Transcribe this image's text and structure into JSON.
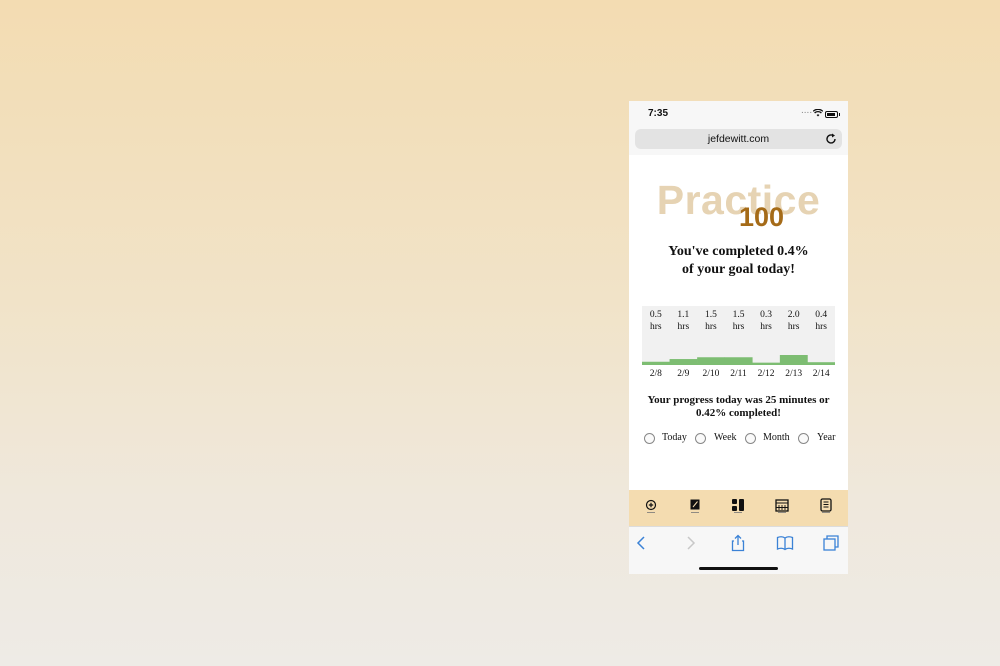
{
  "status": {
    "time": "7:35",
    "signal_dots": "....",
    "icons": [
      "wifi-icon",
      "battery-icon"
    ]
  },
  "browser": {
    "url": "jefdewitt.com",
    "reload_icon": "reload-icon"
  },
  "app": {
    "logo_word": "Practice",
    "logo_number": "100",
    "headline_line1": "You've completed 0.4%",
    "headline_line2": "of your goal today!",
    "progress_line1": "Your progress today was 25 minutes or",
    "progress_line2": "0.42% completed!",
    "range_options": [
      {
        "label": "Today",
        "selected": false
      },
      {
        "label": "Week",
        "selected": false
      },
      {
        "label": "Month",
        "selected": false
      },
      {
        "label": "Year",
        "selected": false
      }
    ],
    "bottom_nav_icons": [
      "add-entry-icon",
      "edit-log-icon",
      "stats-icon",
      "calendar-icon",
      "list-icon"
    ]
  },
  "chart_data": {
    "type": "bar",
    "categories": [
      "2/8",
      "2/9",
      "2/10",
      "2/11",
      "2/12",
      "2/13",
      "2/14"
    ],
    "values": [
      0.5,
      1.1,
      1.5,
      1.5,
      0.3,
      2.0,
      0.4
    ],
    "value_labels": [
      "0.5",
      "1.1",
      "1.5",
      "1.5",
      "0.3",
      "2.0",
      "0.4"
    ],
    "unit_label": "hrs",
    "ylim": [
      0,
      2.0
    ],
    "bar_color": "#7dbd72",
    "background_color": "#f1f1f1"
  },
  "safari_toolbar": [
    "back-icon",
    "forward-icon",
    "share-icon",
    "bookmarks-icon",
    "tabs-icon"
  ],
  "colors": {
    "logo_light": "#e6d3b3",
    "logo_dark": "#a56b18",
    "app_bar": "#f4dcb0",
    "accent_blue": "#3b82d6"
  }
}
